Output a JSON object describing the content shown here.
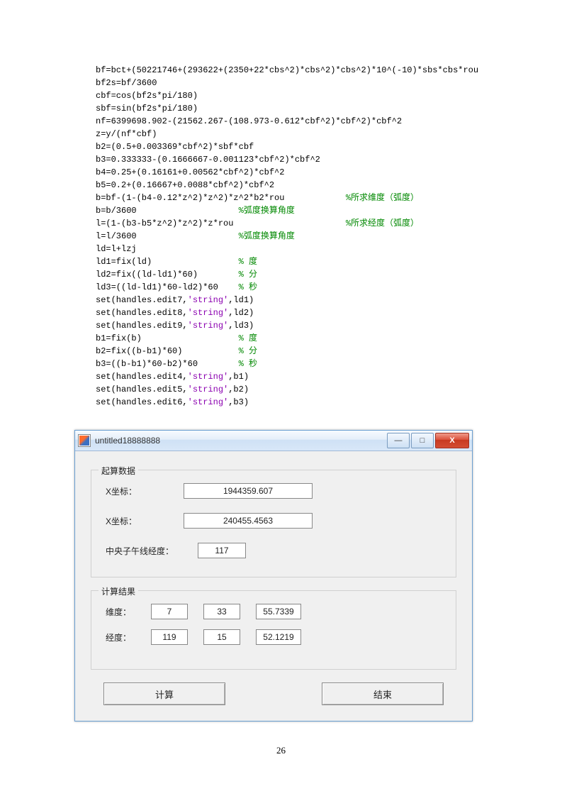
{
  "code": {
    "lines": [
      {
        "segs": [
          {
            "t": "bf=bct+(50221746+(293622+(2350+22*cbs^2)*cbs^2)*cbs^2)*10^(-10)*sbs*cbs*rou"
          }
        ]
      },
      {
        "segs": [
          {
            "t": "bf2s=bf/3600"
          }
        ]
      },
      {
        "segs": [
          {
            "t": "cbf=cos(bf2s*pi/180)"
          }
        ]
      },
      {
        "segs": [
          {
            "t": "sbf=sin(bf2s*pi/180)"
          }
        ]
      },
      {
        "segs": [
          {
            "t": "nf=6399698.902-(21562.267-(108.973-0.612*cbf^2)*cbf^2)*cbf^2"
          }
        ]
      },
      {
        "segs": [
          {
            "t": "z=y/(nf*cbf)"
          }
        ]
      },
      {
        "segs": [
          {
            "t": "b2=(0.5+0.003369*cbf^2)*sbf*cbf"
          }
        ]
      },
      {
        "segs": [
          {
            "t": "b3=0.333333-(0.1666667-0.001123*cbf^2)*cbf^2"
          }
        ]
      },
      {
        "segs": [
          {
            "t": "b4=0.25+(0.16161+0.00562*cbf^2)*cbf^2"
          }
        ]
      },
      {
        "segs": [
          {
            "t": "b5=0.2+(0.16667+0.0088*cbf^2)*cbf^2"
          }
        ]
      },
      {
        "segs": [
          {
            "t": "b=bf-(1-(b4-0.12*z^2)*z^2)*z^2*b2*rou            "
          },
          {
            "t": "%所求维度（弧度）",
            "c": "com"
          }
        ]
      },
      {
        "segs": [
          {
            "t": "b=b/3600                    "
          },
          {
            "t": "%弧度换算角度",
            "c": "com"
          }
        ]
      },
      {
        "segs": [
          {
            "t": "l=(1-(b3-b5*z^2)*z^2)*z*rou                      "
          },
          {
            "t": "%所求经度（弧度）",
            "c": "com"
          }
        ]
      },
      {
        "segs": [
          {
            "t": "l=l/3600                    "
          },
          {
            "t": "%弧度换算角度",
            "c": "com"
          }
        ]
      },
      {
        "segs": [
          {
            "t": "ld=l+lzj"
          }
        ]
      },
      {
        "segs": [
          {
            "t": "ld1=fix(ld)                 "
          },
          {
            "t": "% 度",
            "c": "com"
          }
        ]
      },
      {
        "segs": [
          {
            "t": "ld2=fix((ld-ld1)*60)        "
          },
          {
            "t": "% 分",
            "c": "com"
          }
        ]
      },
      {
        "segs": [
          {
            "t": "ld3=((ld-ld1)*60-ld2)*60    "
          },
          {
            "t": "% 秒",
            "c": "com"
          }
        ]
      },
      {
        "segs": [
          {
            "t": "set(handles.edit7,"
          },
          {
            "t": "'string'",
            "c": "str"
          },
          {
            "t": ",ld1)"
          }
        ]
      },
      {
        "segs": [
          {
            "t": "set(handles.edit8,"
          },
          {
            "t": "'string'",
            "c": "str"
          },
          {
            "t": ",ld2)"
          }
        ]
      },
      {
        "segs": [
          {
            "t": "set(handles.edit9,"
          },
          {
            "t": "'string'",
            "c": "str"
          },
          {
            "t": ",ld3)"
          }
        ]
      },
      {
        "segs": [
          {
            "t": "b1=fix(b)                   "
          },
          {
            "t": "% 度",
            "c": "com"
          }
        ]
      },
      {
        "segs": [
          {
            "t": "b2=fix((b-b1)*60)           "
          },
          {
            "t": "% 分",
            "c": "com"
          }
        ]
      },
      {
        "segs": [
          {
            "t": "b3=((b-b1)*60-b2)*60        "
          },
          {
            "t": "% 秒",
            "c": "com"
          }
        ]
      },
      {
        "segs": [
          {
            "t": "set(handles.edit4,"
          },
          {
            "t": "'string'",
            "c": "str"
          },
          {
            "t": ",b1)"
          }
        ]
      },
      {
        "segs": [
          {
            "t": "set(handles.edit5,"
          },
          {
            "t": "'string'",
            "c": "str"
          },
          {
            "t": ",b2)"
          }
        ]
      },
      {
        "segs": [
          {
            "t": "set(handles.edit6,"
          },
          {
            "t": "'string'",
            "c": "str"
          },
          {
            "t": ",b3)"
          }
        ]
      }
    ]
  },
  "window": {
    "title": "untitled18888888",
    "btn_min": "—",
    "btn_max": "□",
    "btn_close": "X",
    "group_input": {
      "legend": "起算数据",
      "row1_label": "X坐标：",
      "row1_value": "1944359.607",
      "row2_label": "X坐标：",
      "row2_value": "240455.4563",
      "row3_label": "中央子午线经度：",
      "row3_value": "117"
    },
    "group_output": {
      "legend": "计算结果",
      "lat_label": "维度：",
      "lat_d": "7",
      "lat_m": "33",
      "lat_s": "55.7339",
      "lon_label": "经度：",
      "lon_d": "119",
      "lon_m": "15",
      "lon_s": "52.1219"
    },
    "btn_calc": "计算",
    "btn_end": "结束"
  },
  "page_number": "26"
}
